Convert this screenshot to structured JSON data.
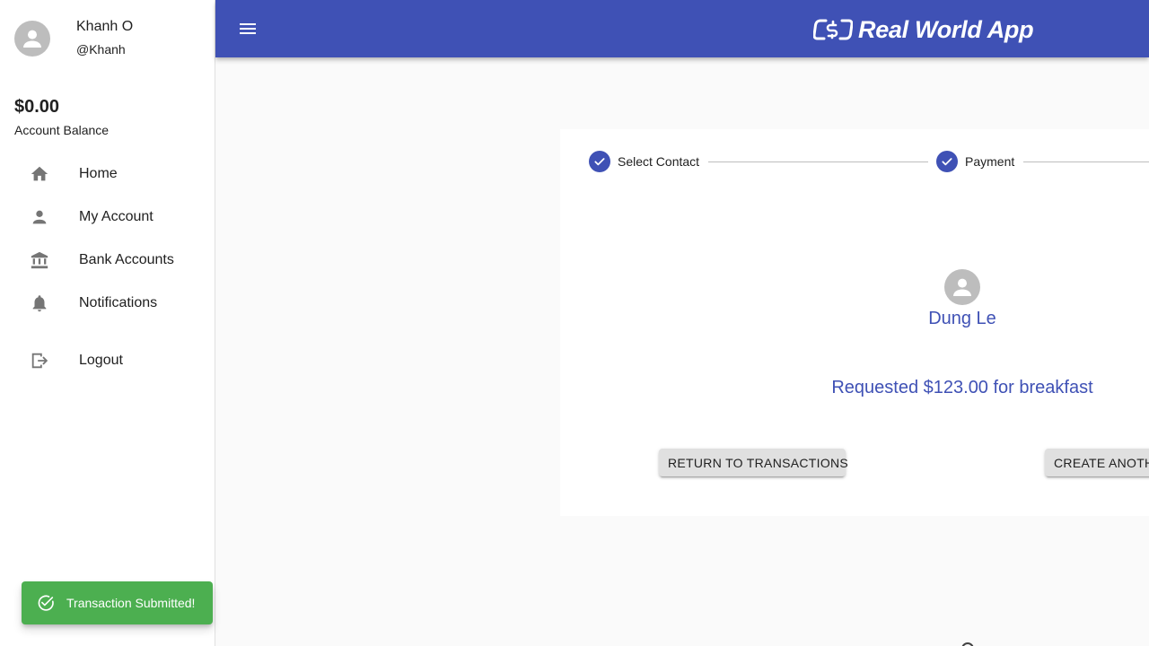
{
  "app": {
    "title": "Real World App",
    "colors": {
      "primary": "#3f51b5",
      "success": "#4caf50",
      "drawer_bg": "#ffffff",
      "page_bg": "#fafafa"
    }
  },
  "user": {
    "full_name": "Khanh O",
    "handle": "@Khanh",
    "balance": "$0.00",
    "balance_label": "Account Balance"
  },
  "nav": {
    "items": [
      {
        "label": "Home",
        "icon": "home-icon"
      },
      {
        "label": "My Account",
        "icon": "person-icon"
      },
      {
        "label": "Bank Accounts",
        "icon": "bank-icon"
      },
      {
        "label": "Notifications",
        "icon": "bell-icon"
      }
    ],
    "logout_label": "Logout"
  },
  "toast": {
    "message": "Transaction Submitted!",
    "icon": "check-circle-icon"
  },
  "stepper": {
    "steps": [
      {
        "label": "Select Contact",
        "completed": true
      },
      {
        "label": "Payment",
        "completed": true
      }
    ]
  },
  "result": {
    "contact_name": "Dung Le",
    "message": "Requested $123.00 for breakfast",
    "return_button": "RETURN TO TRANSACTIONS",
    "create_button": "CREATE ANOTH"
  }
}
